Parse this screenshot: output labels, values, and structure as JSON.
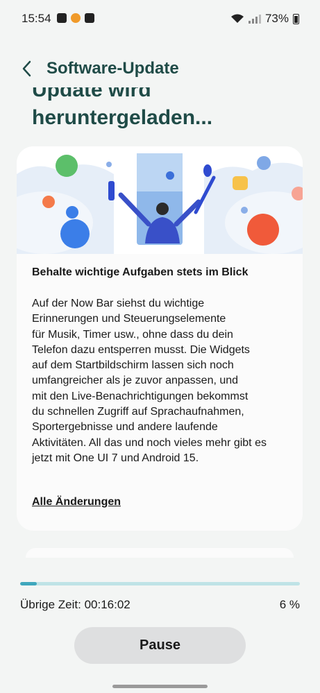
{
  "status_bar": {
    "time": "15:54",
    "battery": "73%"
  },
  "header": {
    "title": "Software-Update"
  },
  "update_title": {
    "line1": "Update wird",
    "line2": "heruntergeladen..."
  },
  "card": {
    "heading": "Behalte wichtige Aufgaben stets im Blick",
    "body": "Auf der Now Bar siehst du wichtige\nErinnerungen und Steuerungselemente\nfür Musik, Timer usw., ohne dass du dein\nTelefon dazu entsperren musst. Die Widgets\nauf dem Startbildschirm lassen sich noch\numfangreicher als je zuvor anpassen, und\nmit den Live-Benachrichtigungen bekommst\ndu schnellen Zugriff auf Sprachaufnahmen,\nSportergebnisse und andere laufende\nAktivitäten. All das und noch vieles mehr gibt es\njetzt mit One UI 7 und Android 15.",
    "all_changes_link": "Alle Änderungen"
  },
  "download": {
    "time_left": "Übrige Zeit: 00:16:02",
    "percent_label": "6 %",
    "progress": 0.06
  },
  "pause_button": "Pause",
  "colors": {
    "title_teal": "#1f4b47",
    "progress_fill": "#3fa7bd",
    "progress_track": "#bfe3e6"
  }
}
